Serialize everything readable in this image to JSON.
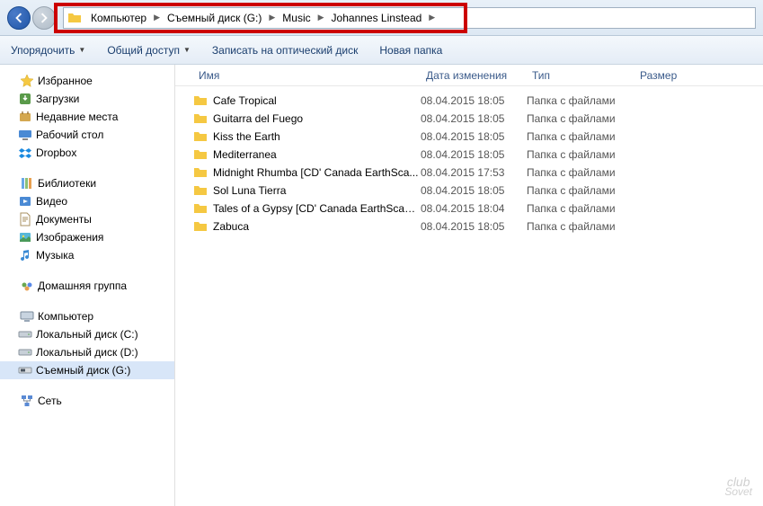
{
  "breadcrumb": [
    "Компьютер",
    "Съемный диск (G:)",
    "Music",
    "Johannes Linstead"
  ],
  "toolbar": {
    "organize": "Упорядочить",
    "share": "Общий доступ",
    "burn": "Записать на оптический диск",
    "new_folder": "Новая папка"
  },
  "columns": {
    "name": "Имя",
    "date": "Дата изменения",
    "type": "Тип",
    "size": "Размер"
  },
  "sidebar": {
    "favorites": {
      "label": "Избранное",
      "items": [
        "Загрузки",
        "Недавние места",
        "Рабочий стол",
        "Dropbox"
      ]
    },
    "libraries": {
      "label": "Библиотеки",
      "items": [
        "Видео",
        "Документы",
        "Изображения",
        "Музыка"
      ]
    },
    "homegroup": {
      "label": "Домашняя группа"
    },
    "computer": {
      "label": "Компьютер",
      "items": [
        "Локальный диск (C:)",
        "Локальный диск (D:)",
        "Съемный диск (G:)"
      ]
    },
    "network": {
      "label": "Сеть"
    }
  },
  "files": [
    {
      "name": "Cafe Tropical",
      "date": "08.04.2015 18:05",
      "type": "Папка с файлами"
    },
    {
      "name": "Guitarra del Fuego",
      "date": "08.04.2015 18:05",
      "type": "Папка с файлами"
    },
    {
      "name": "Kiss the Earth",
      "date": "08.04.2015 18:05",
      "type": "Папка с файлами"
    },
    {
      "name": "Mediterranea",
      "date": "08.04.2015 18:05",
      "type": "Папка с файлами"
    },
    {
      "name": "Midnight Rhumba [CD' Canada EarthSca...",
      "date": "08.04.2015 17:53",
      "type": "Папка с файлами"
    },
    {
      "name": "Sol Luna Tierra",
      "date": "08.04.2015 18:05",
      "type": "Папка с файлами"
    },
    {
      "name": "Tales of a Gypsy [CD' Canada EarthScape...",
      "date": "08.04.2015 18:04",
      "type": "Папка с файлами"
    },
    {
      "name": "Zabuca",
      "date": "08.04.2015 18:05",
      "type": "Папка с файлами"
    }
  ],
  "watermark": {
    "top": "club",
    "bottom": "Sovet"
  }
}
